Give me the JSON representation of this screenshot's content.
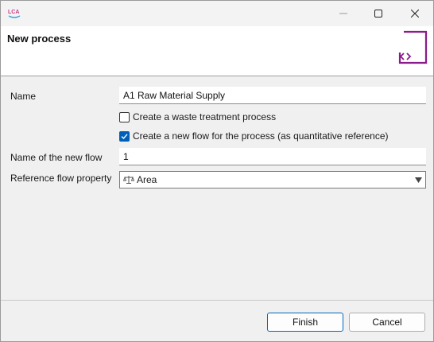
{
  "window": {
    "app_logo_text": "LCA",
    "minimize_icon": "minimize-icon",
    "maximize_icon": "maximize-icon",
    "close_icon": "close-icon"
  },
  "header": {
    "title": "New process",
    "icon": "process-wizard-icon",
    "accent_color": "#8b1a8b"
  },
  "form": {
    "name_label": "Name",
    "name_value": "A1 Raw Material Supply",
    "waste_checkbox_label": "Create a waste treatment process",
    "waste_checked": false,
    "new_flow_checkbox_label": "Create a new flow for the process (as quantitative reference)",
    "new_flow_checked": true,
    "flow_name_label": "Name of the new flow",
    "flow_name_value": "1",
    "ref_property_label": "Reference flow property",
    "ref_property_icon": "scale-icon",
    "ref_property_value": "Area"
  },
  "buttons": {
    "finish": "Finish",
    "cancel": "Cancel"
  },
  "colors": {
    "check_accent": "#005fb8",
    "default_button_border": "#0067c0"
  }
}
